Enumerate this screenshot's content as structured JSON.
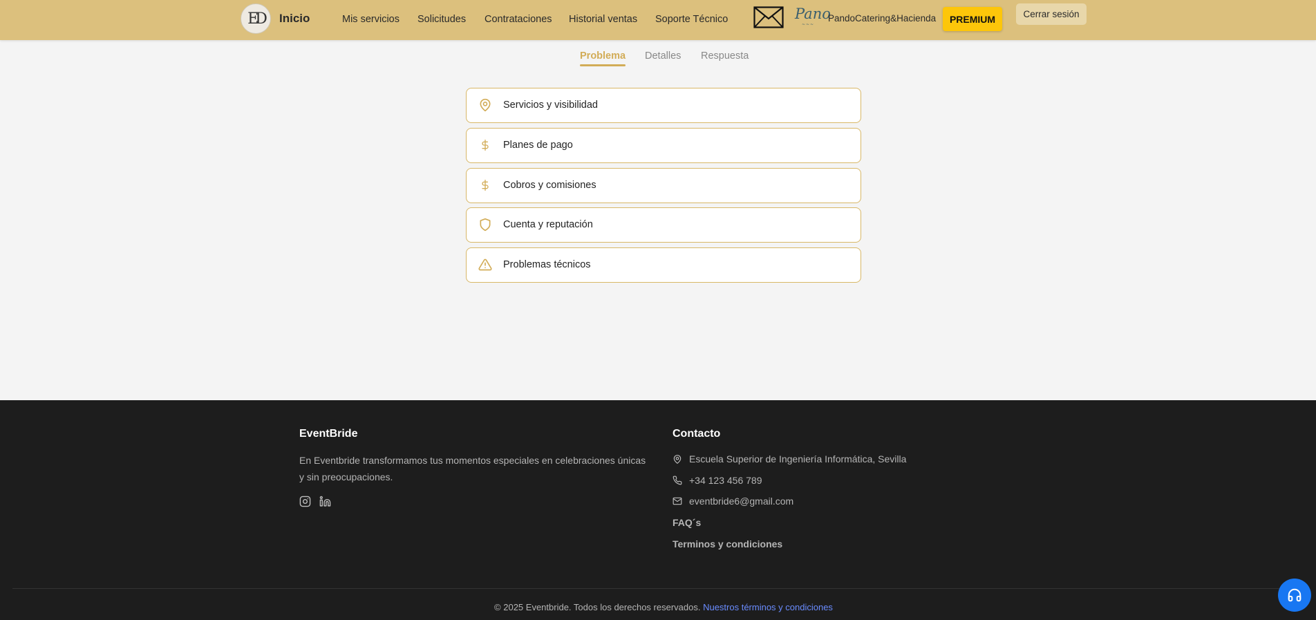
{
  "header": {
    "logo_text": "ED",
    "home_label": "Inicio",
    "nav": [
      "Mis servicios",
      "Solicitudes",
      "Contrataciones",
      "Historial ventas",
      "Soporte Técnico"
    ],
    "business_logo_text": "Pano",
    "username": "PandoCatering&Hacienda",
    "premium_label": "PREMIUM",
    "logout_label": "Cerrar sesión"
  },
  "steps": [
    "Problema",
    "Detalles",
    "Respuesta"
  ],
  "categories": [
    {
      "label": "Servicios y visibilidad",
      "icon": "map-pin-icon"
    },
    {
      "label": "Planes de pago",
      "icon": "dollar-icon"
    },
    {
      "label": "Cobros y comisiones",
      "icon": "dollar-icon"
    },
    {
      "label": "Cuenta y reputación",
      "icon": "shield-icon"
    },
    {
      "label": "Problemas técnicos",
      "icon": "warning-icon"
    }
  ],
  "footer": {
    "brand": "EventBride",
    "description": "En Eventbride transformamos tus momentos especiales en celebraciones únicas y sin preocupaciones.",
    "contact_title": "Contacto",
    "address": "Escuela Superior de Ingeniería Informática, Sevilla",
    "phone": "+34 123 456 789",
    "email": "eventbride6@gmail.com",
    "faq_label": "FAQ´s",
    "terms_label": "Terminos y condiciones",
    "copyright": "© 2025 Eventbride. Todos los derechos reservados.",
    "copyright_link": "Nuestros términos y condiciones"
  },
  "colors": {
    "header_bg": "#dcc07d",
    "accent": "#d2ac57",
    "premium": "#fdc60a",
    "footer_bg": "#1d1d1d",
    "support_button": "#1877f2"
  }
}
